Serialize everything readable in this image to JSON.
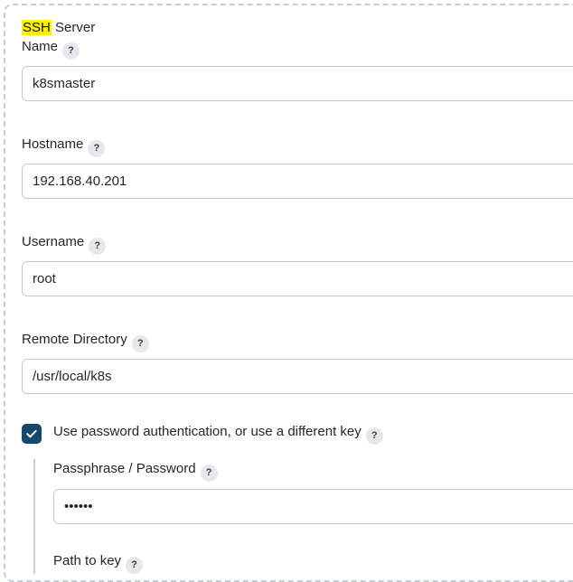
{
  "form": {
    "fields": [
      {
        "id": "ssh-server-name",
        "label_highlight": "SSH",
        "label_rest": " Server Name",
        "help": "?",
        "value": "k8smaster",
        "placeholder": ""
      },
      {
        "id": "hostname",
        "label": "Hostname",
        "help": "?",
        "value": "192.168.40.201",
        "placeholder": ""
      },
      {
        "id": "username",
        "label": "Username",
        "help": "?",
        "value": "root",
        "placeholder": ""
      },
      {
        "id": "remote-directory",
        "label": "Remote Directory",
        "help": "?",
        "value": "/usr/local/k8s",
        "placeholder": ""
      }
    ],
    "password_auth": {
      "checkbox_label": "Use password authentication, or use a different key",
      "checkbox_help": "?",
      "checked": true,
      "passphrase_label": "Passphrase / Password",
      "passphrase_help": "?",
      "passphrase_value": "••••••",
      "path_to_key_label": "Path to key",
      "path_to_key_help": "?"
    }
  },
  "colors": {
    "highlight": "#fff200",
    "checkbox_fill": "#14496b",
    "input_border": "#c0ccd2",
    "dashed_border": "#c3ced4",
    "help_badge": "#e6e8eb",
    "text": "#22272b"
  }
}
